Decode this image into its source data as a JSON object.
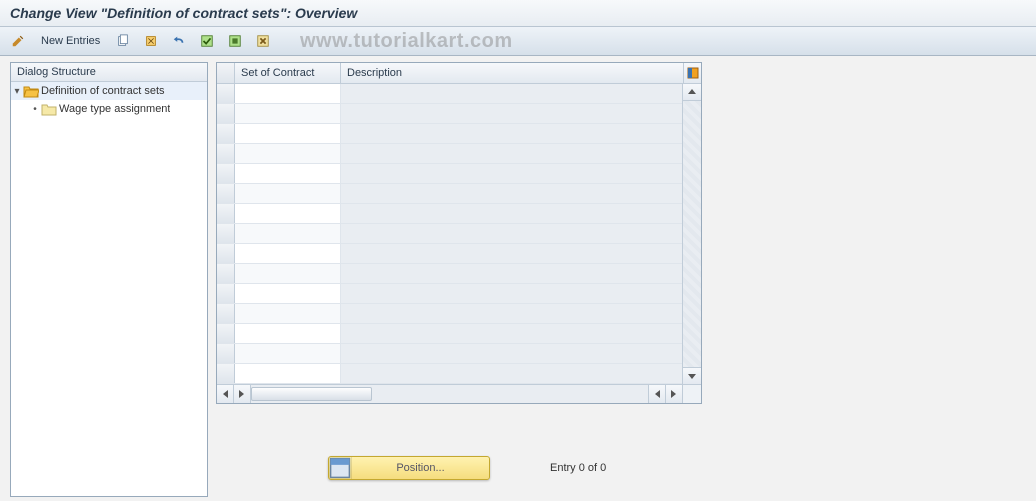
{
  "title": "Change View \"Definition of contract sets\": Overview",
  "watermark": "www.tutorialkart.com",
  "toolbar": {
    "new_entries_label": "New Entries"
  },
  "dialog_structure": {
    "header": "Dialog Structure",
    "items": [
      {
        "label": "Definition of contract sets",
        "expanded": true,
        "selected": true,
        "level": 0
      },
      {
        "label": "Wage type assignment",
        "expanded": false,
        "selected": false,
        "level": 1
      }
    ]
  },
  "table": {
    "columns": [
      {
        "label": "Set of Contract"
      },
      {
        "label": "Description"
      }
    ],
    "rows": []
  },
  "footer": {
    "position_label": "Position...",
    "entry_text": "Entry 0 of 0"
  }
}
